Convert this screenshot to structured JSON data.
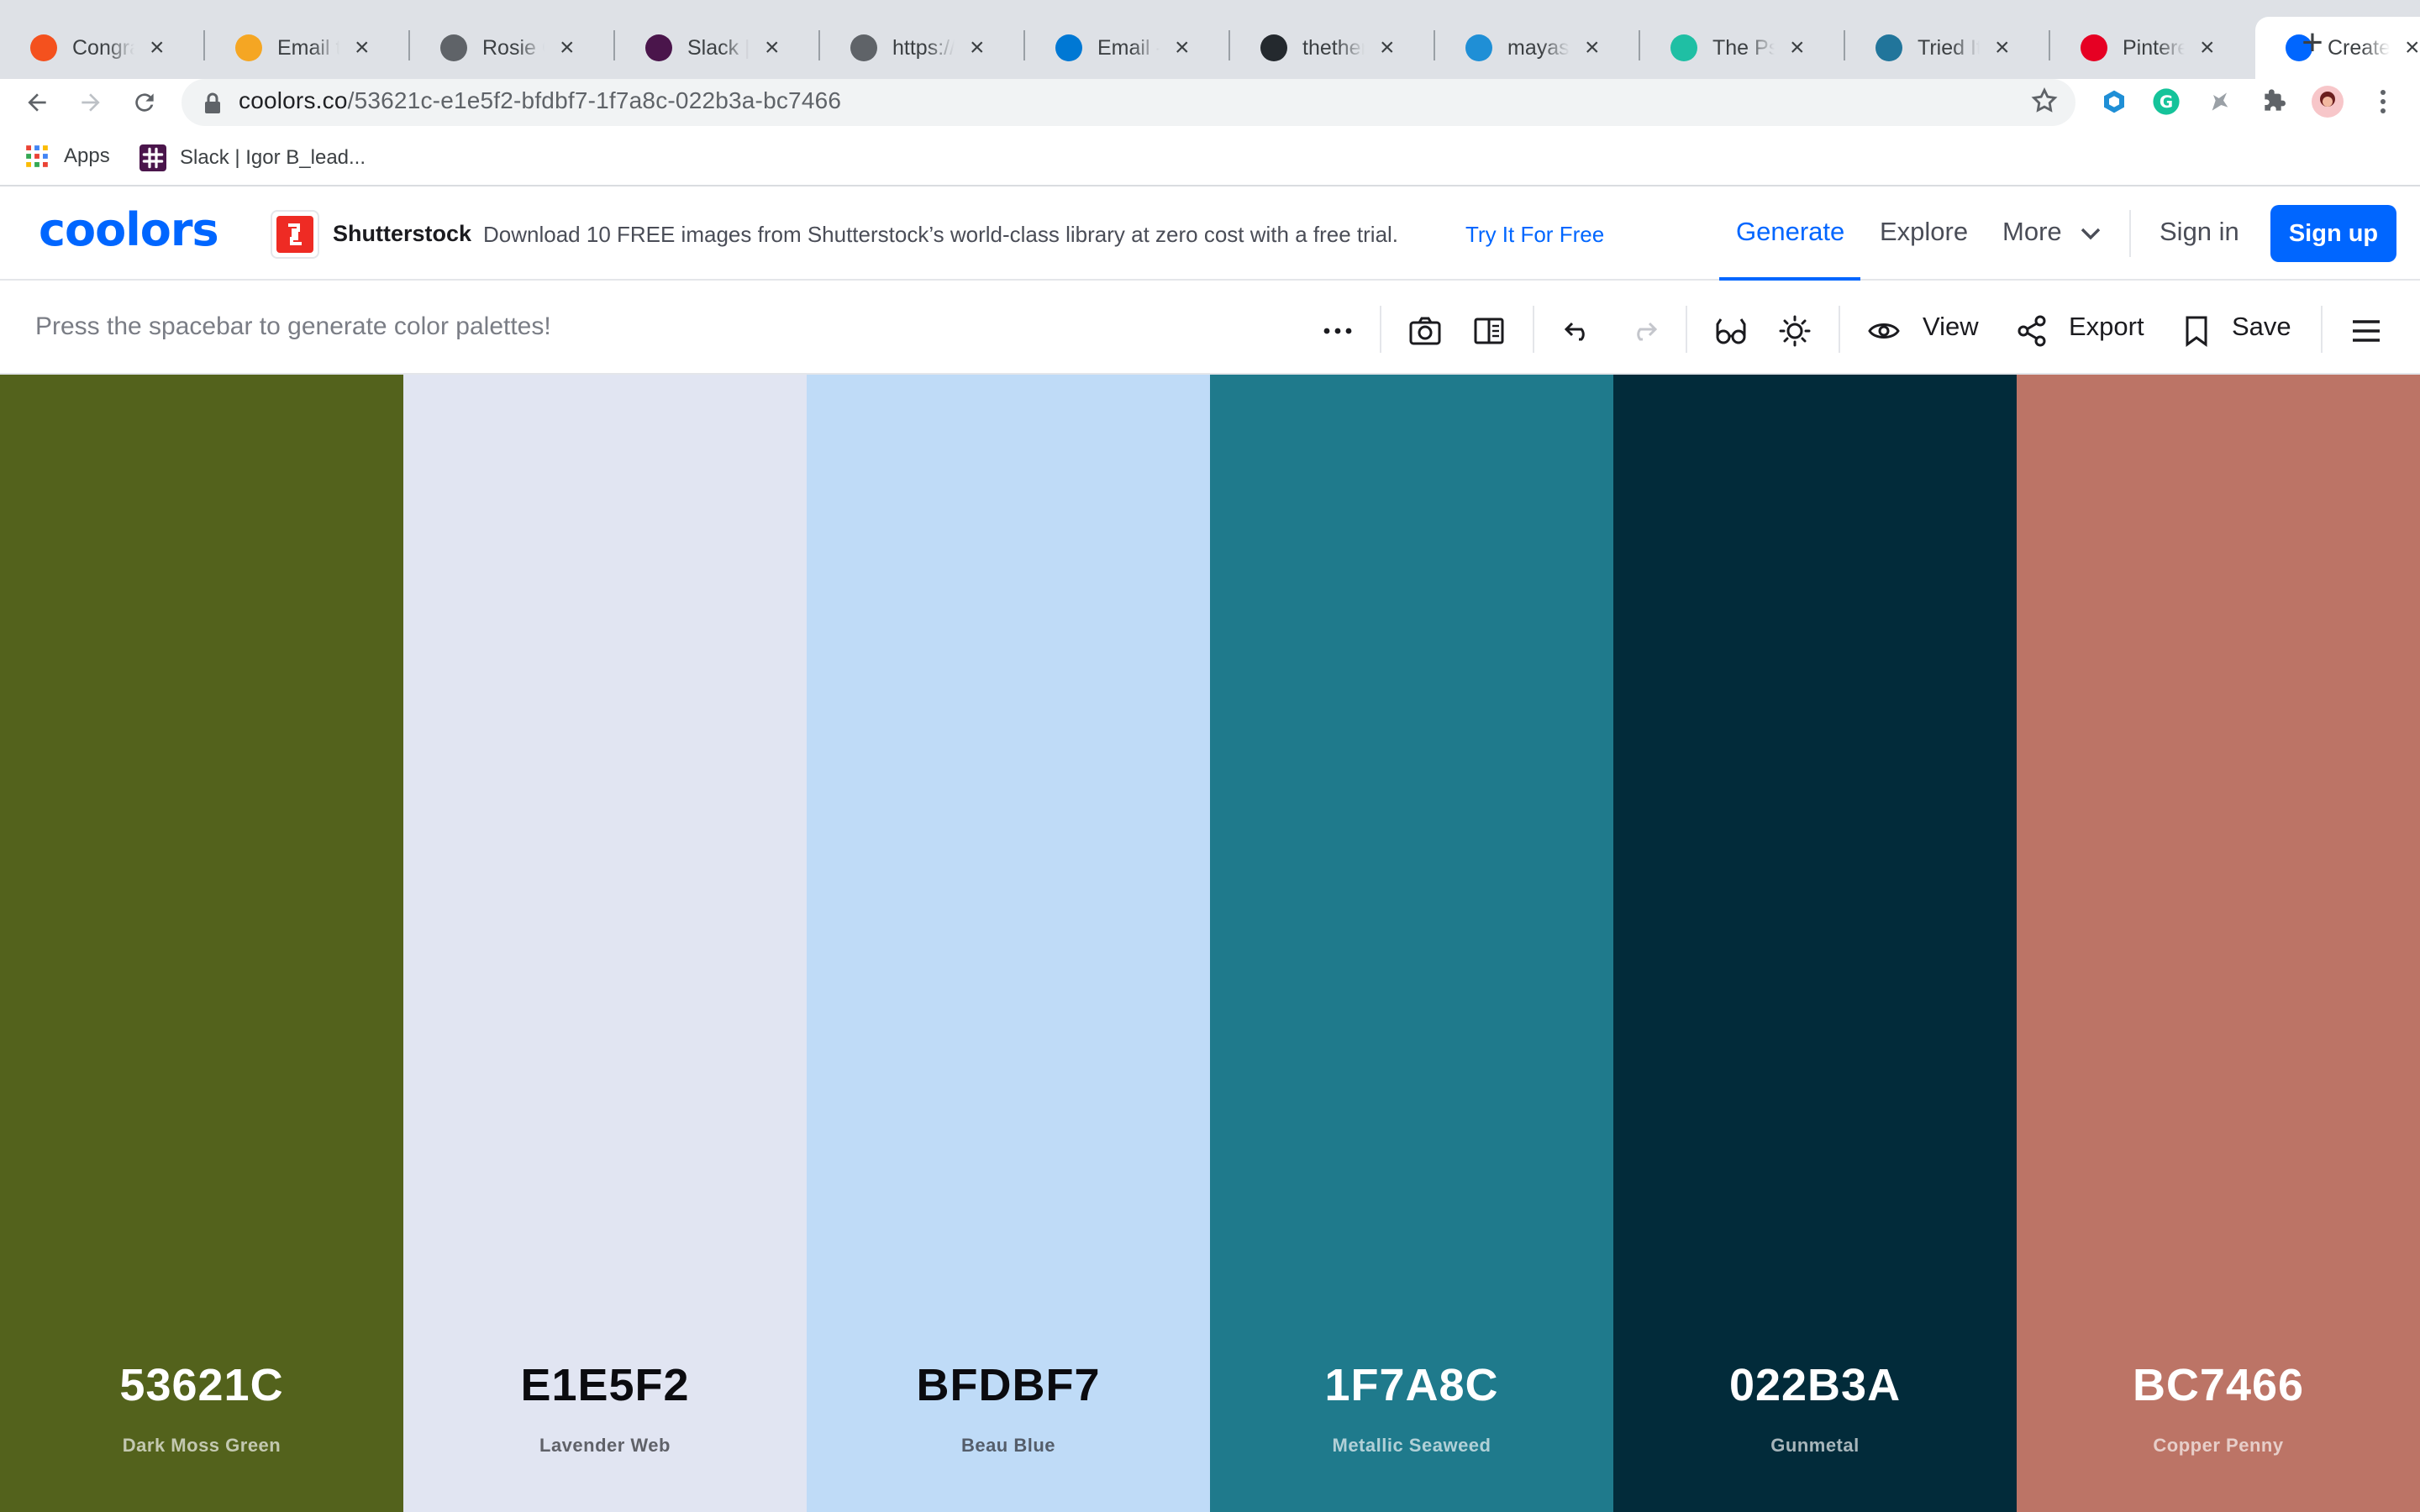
{
  "browser": {
    "tabs": [
      {
        "title": "Congratulations",
        "favicon": "orange-ring-icon",
        "color": "#f4511e"
      },
      {
        "title": "Email templates",
        "favicon": "mail-envelope-icon",
        "color": "#f5a623"
      },
      {
        "title": "Rosie Odessa",
        "favicon": "globe-icon",
        "color": "#5f6368"
      },
      {
        "title": "Slack | *",
        "favicon": "slack-icon",
        "color": "#4a154b"
      },
      {
        "title": "https://m",
        "favicon": "globe-icon",
        "color": "#5f6368"
      },
      {
        "title": "Email - M",
        "favicon": "outlook-icon",
        "color": "#0078d4"
      },
      {
        "title": "thetherapy",
        "favicon": "github-icon",
        "color": "#24292e"
      },
      {
        "title": "mayasaf",
        "favicon": "hexagon-icon",
        "color": "#1f8fd6"
      },
      {
        "title": "The Psych",
        "favicon": "z-circle-icon",
        "color": "#1fbfa4"
      },
      {
        "title": "Tried It F",
        "favicon": "wordpress-icon",
        "color": "#21759b"
      },
      {
        "title": "Pinterest",
        "favicon": "pinterest-icon",
        "color": "#e60023"
      },
      {
        "title": "Create a",
        "favicon": "coolors-icon",
        "color": "#0066ff"
      }
    ],
    "url_host": "coolors.co",
    "url_path": "/53621c-e1e5f2-bfdbf7-1f7a8c-022b3a-bc7466",
    "bookmarks": [
      {
        "label": "Apps",
        "icon": "apps-grid-icon"
      },
      {
        "label": "Slack | Igor B_lead...",
        "icon": "slack-icon"
      }
    ]
  },
  "header": {
    "logo": "coolors",
    "ad": {
      "brand": "Shutterstock",
      "text": "Download 10 FREE images from Shutterstock’s world-class library at zero cost with a free trial.",
      "cta": "Try It For Free"
    },
    "nav": {
      "generate": "Generate",
      "explore": "Explore",
      "more": "More",
      "sign_in": "Sign in",
      "sign_up": "Sign up"
    }
  },
  "toolbar": {
    "hint": "Press the spacebar to generate color palettes!",
    "view_label": "View",
    "export_label": "Export",
    "save_label": "Save"
  },
  "palette": [
    {
      "hex": "53621C",
      "name": "Dark Moss Green",
      "color": "#53621c",
      "tone": "dark"
    },
    {
      "hex": "E1E5F2",
      "name": "Lavender Web",
      "color": "#e1e5f2",
      "tone": "light"
    },
    {
      "hex": "BFDBF7",
      "name": "Beau Blue",
      "color": "#bfdbf7",
      "tone": "light"
    },
    {
      "hex": "1F7A8C",
      "name": "Metallic Seaweed",
      "color": "#1f7a8c",
      "tone": "dark"
    },
    {
      "hex": "022B3A",
      "name": "Gunmetal",
      "color": "#022b3a",
      "tone": "dark"
    },
    {
      "hex": "BC7466",
      "name": "Copper Penny",
      "color": "#bc7466",
      "tone": "dark"
    }
  ]
}
